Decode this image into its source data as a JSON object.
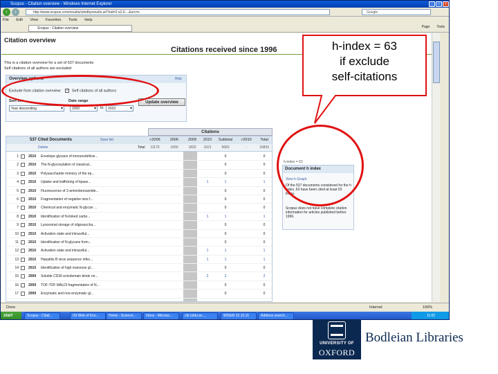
{
  "browser": {
    "window_title": "Scopus - Citation overview - Windows Internet Explorer",
    "address": "http://www.scopus.com/results/citedbyresults.url?eid=2-s2.0-...&src=s",
    "search_placeholder": "Google",
    "menu": [
      "File",
      "Edit",
      "View",
      "Favorites",
      "Tools",
      "Help"
    ],
    "tab_title": "Scopus - Citation overview",
    "commands": [
      "Page",
      "Tools"
    ]
  },
  "page": {
    "title": "Citation overview",
    "heading": "Citations received since 1996",
    "line1": "This is a citation overview for a set of 537 documents",
    "line2": "Self citations of all authors are excluded",
    "overview": {
      "title": "Overview options",
      "help": "Help",
      "exclude_label": "Exclude from citation overview:",
      "exclude_option": "Self citations of all authors",
      "sort_label": "Sort on:",
      "sort_value": "Year descending",
      "date_label": "Date range",
      "date_from": "2000",
      "date_to_label": "to",
      "date_to": "2010",
      "update_button": "Update overview"
    },
    "table": {
      "citations_label": "Citations",
      "cited_docs": "537 Cited Documents",
      "save": "Save list",
      "delete": "Delete",
      "total": "Total",
      "years": [
        {
          "y": "<2006",
          "total": "11170"
        },
        {
          "y": "2006",
          "total": "1650"
        },
        {
          "y": "2009",
          "total": "1832"
        },
        {
          "y": "2010",
          "total": "1621"
        },
        {
          "y": "Subtotal",
          "total": "5663"
        },
        {
          "y": ">2010",
          "total": "-"
        },
        {
          "y": "Total",
          "total": "16833"
        }
      ],
      "rows": [
        {
          "n": "1",
          "year": "2010",
          "title": "Envelope glycans of immunodeficie...",
          "v": [
            "",
            "",
            "",
            "",
            "0",
            "",
            "0"
          ]
        },
        {
          "n": "2",
          "year": "2010",
          "title": "The N-glycosylation of classical...",
          "v": [
            "",
            "",
            "",
            "",
            "0",
            "",
            "0"
          ]
        },
        {
          "n": "3",
          "year": "2010",
          "title": "Polysaccharide mimicry of the ep...",
          "v": [
            "",
            "",
            "",
            "",
            "0",
            "",
            "0"
          ]
        },
        {
          "n": "4",
          "year": "2010",
          "title": "Uptake and trafficking of lipase...",
          "v": [
            "",
            "",
            "",
            "1",
            "1",
            "",
            "1"
          ]
        },
        {
          "n": "5",
          "year": "2010",
          "title": "Fluorescence of 2-aminobenzamide...",
          "v": [
            "",
            "",
            "",
            "",
            "0",
            "",
            "0"
          ]
        },
        {
          "n": "6",
          "year": "2010",
          "title": "Fragmentation of negative ions f...",
          "v": [
            "",
            "",
            "",
            "",
            "0",
            "",
            "0"
          ]
        },
        {
          "n": "7",
          "year": "2010",
          "title": "Chemical and enzymatic N-glycan ...",
          "v": [
            "",
            "",
            "",
            "",
            "0",
            "",
            "0"
          ]
        },
        {
          "n": "8",
          "year": "2010",
          "title": "Identification of N-linked carbo...",
          "v": [
            "",
            "",
            "",
            "1",
            "1",
            "",
            "1"
          ]
        },
        {
          "n": "9",
          "year": "2010",
          "title": "Lysosomal storage of oligosaccha...",
          "v": [
            "",
            "",
            "",
            "",
            "0",
            "",
            "0"
          ]
        },
        {
          "n": "10",
          "year": "2010",
          "title": "Activation state and intracellul...",
          "v": [
            "",
            "",
            "",
            "",
            "0",
            "",
            "0"
          ]
        },
        {
          "n": "11",
          "year": "2010",
          "title": "Identification of N-glycans from...",
          "v": [
            "",
            "",
            "",
            "",
            "0",
            "",
            "0"
          ]
        },
        {
          "n": "12",
          "year": "2010",
          "title": "Activation state and intracellul...",
          "v": [
            "",
            "",
            "",
            "1",
            "1",
            "",
            "1"
          ]
        },
        {
          "n": "13",
          "year": "2010",
          "title": "Hepatitis B virus sequence infec...",
          "v": [
            "",
            "",
            "",
            "1",
            "1",
            "",
            "1"
          ]
        },
        {
          "n": "14",
          "year": "2010",
          "title": "Identification of high mannose gl...",
          "v": [
            "",
            "",
            "",
            "",
            "0",
            "",
            "0"
          ]
        },
        {
          "n": "15",
          "year": "2009",
          "title": "Soluble CD36 ectodomain binds ne...",
          "v": [
            "",
            "",
            "",
            "2",
            "2",
            "",
            "2"
          ]
        },
        {
          "n": "16",
          "year": "2009",
          "title": "TOF-TOF MALDI fragmentation of N...",
          "v": [
            "",
            "",
            "",
            "",
            "0",
            "",
            "0"
          ]
        },
        {
          "n": "17",
          "year": "2009",
          "title": "Enzymatic and non-enzymatic gl...",
          "v": [
            "",
            "",
            "",
            "",
            "0",
            "",
            "0"
          ]
        }
      ]
    },
    "hindex": {
      "above": "h-index = 63",
      "title": "Document h index",
      "link": "View h-Graph",
      "text1": "Of the 537 documents considered for the h index, 63 have been cited at least 63 times.",
      "text2": "Scopus does not have complete citation information for articles published before 1996."
    }
  },
  "statusbar": {
    "done": "Done",
    "zone": "Internet",
    "zoom": "100%"
  },
  "taskbar": {
    "start": "start",
    "tasks": [
      "Scopus - Citati...",
      "ISI Web of Kno...",
      "Home - Science...",
      "Inbox - Microso...",
      "cib (oldu.ac....",
      "WISER 22.10.11",
      "Address search..."
    ],
    "clock": "11:02"
  },
  "annotation": {
    "callout": "h-index = 63\nif exclude\nself-citations",
    "callout_lines": [
      "h-index = 63",
      "if exclude",
      "self-citations"
    ]
  },
  "branding": {
    "university_line1": "UNIVERSITY OF",
    "university_line2": "OXFORD",
    "library": "Bodleian Libraries"
  },
  "colors": {
    "annotation_red": "#e01010",
    "oxford_blue": "#0b2850",
    "scopus_green": "#7c9a3d"
  }
}
